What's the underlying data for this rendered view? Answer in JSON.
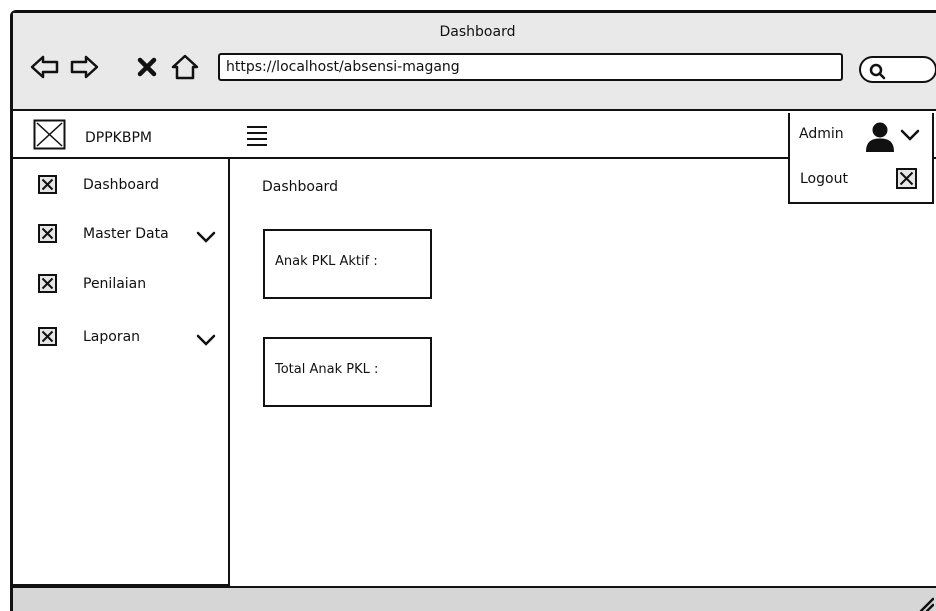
{
  "window": {
    "title": "Dashboard"
  },
  "browser": {
    "url": "https://localhost/absensi-magang",
    "nav_icons": [
      "back-arrow-icon",
      "forward-arrow-icon",
      "close-x-icon",
      "home-icon"
    ],
    "search_icon": "search-icon"
  },
  "header": {
    "brand": "DPPKBPM",
    "menu_icon": "hamburger-menu-icon",
    "user": {
      "label": "Admin",
      "icon": "user-avatar-icon"
    },
    "dropdown": {
      "logout_label": "Logout"
    }
  },
  "sidebar": {
    "items": [
      {
        "label": "Dashboard",
        "has_submenu": false
      },
      {
        "label": "Master Data",
        "has_submenu": true
      },
      {
        "label": "Penilaian",
        "has_submenu": false
      },
      {
        "label": "Laporan",
        "has_submenu": true
      }
    ]
  },
  "main": {
    "heading": "Dashboard",
    "cards": [
      {
        "label": "Anak PKL Aktif :"
      },
      {
        "label": "Total Anak PKL :"
      }
    ]
  }
}
